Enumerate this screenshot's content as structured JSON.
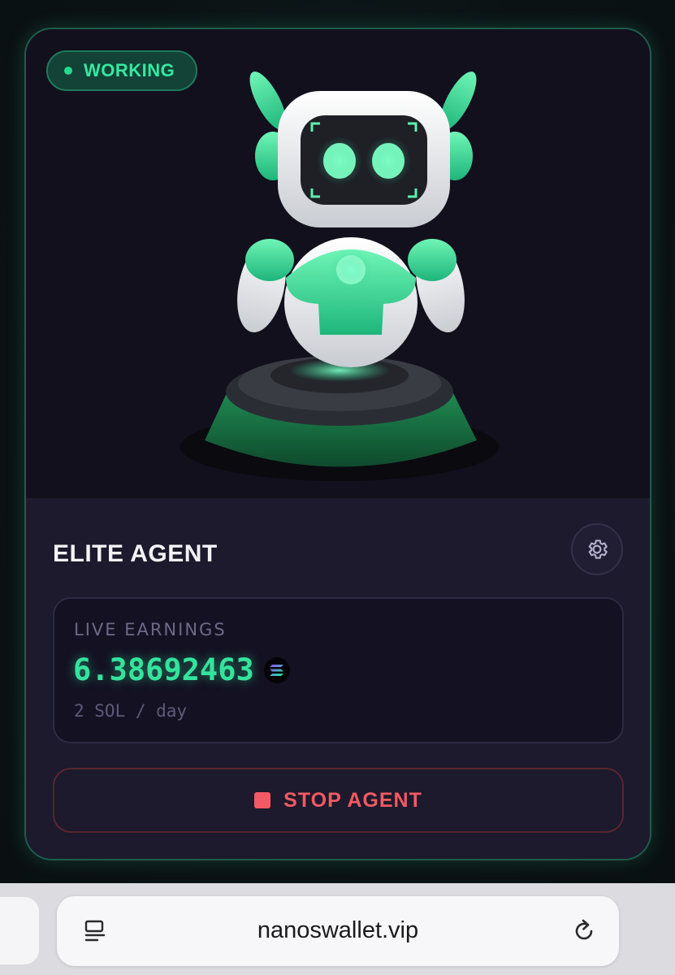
{
  "agent_card": {
    "status": "WORKING",
    "title": "ELITE AGENT",
    "earnings": {
      "label": "LIVE EARNINGS",
      "value": "6.38692463",
      "currency_icon": "solana-icon",
      "rate": "2 SOL / day"
    },
    "stop_button_label": "STOP AGENT",
    "settings_icon": "gear-icon"
  },
  "browser": {
    "url": "nanoswallet.vip",
    "reader_icon": "reader-mode-icon",
    "reload_icon": "reload-icon"
  },
  "colors": {
    "accent_green": "#34e39c",
    "stop_red": "#f25a63",
    "card_bg": "#1c1a2c",
    "card_border": "#1f5c4a"
  }
}
